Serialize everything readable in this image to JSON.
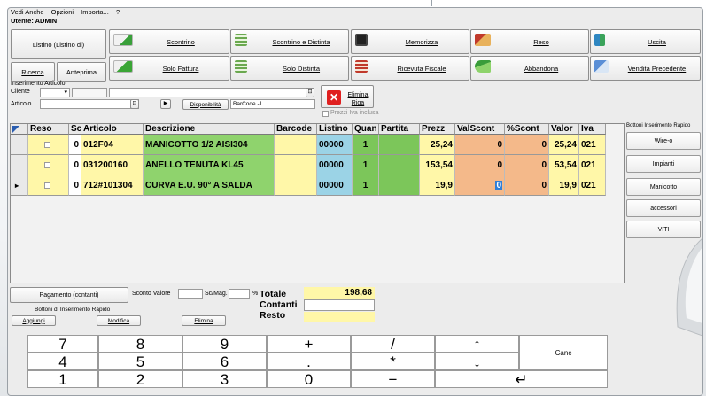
{
  "menu": [
    "Vedi Anche",
    "Opzioni",
    "Importa...",
    "?"
  ],
  "user_label": "Utente: ADMIN",
  "left_buttons": {
    "listino": "Listino (Listino di)",
    "ricerca": "Ricerca",
    "anteprima": "Anteprima"
  },
  "toolbar": {
    "scontrino": "Scontrino",
    "scontrino_distinta": "Scontrino e Distinta",
    "memorizza": "Memorizza",
    "reso": "Reso",
    "uscita": "Uscita",
    "solo_fattura": "Solo Fattura",
    "solo_distinta": "Solo Distinta",
    "ricevuta_fiscale": "Ricevuta Fiscale",
    "abbandona": "Abbandona",
    "vendita_precedente": "Vendita Precedente"
  },
  "insert": {
    "section_label": "Inserimento Articolo",
    "cliente_label": "Cliente",
    "articolo_label": "Articolo",
    "disponibilita": "Disponibilità",
    "barcode_value": "BarCode -1",
    "elimina_riga": "Elimina Riga",
    "prezzi_iva": "Prezzi Iva inclusa"
  },
  "grid": {
    "headers": [
      "Reso",
      "Sc",
      "Articolo",
      "Descrizione",
      "Barcode",
      "Listino",
      "Quan",
      "Partita",
      "Prezz",
      "ValScont",
      "%Scont",
      "Valor",
      "Iva"
    ],
    "rows": [
      {
        "sc": "0",
        "articolo": "012F04",
        "descrizione": "MANICOTTO 1/2 AISI304",
        "barcode": "",
        "listino": "00000",
        "quan": "1",
        "partita": "",
        "prezzo": "25,24",
        "valscont": "0",
        "pscont": "0",
        "valore": "25,24",
        "iva": "021"
      },
      {
        "sc": "0",
        "articolo": "031200160",
        "descrizione": "ANELLO TENUTA KL45",
        "barcode": "",
        "listino": "00000",
        "quan": "1",
        "partita": "",
        "prezzo": "153,54",
        "valscont": "0",
        "pscont": "0",
        "valore": "53,54",
        "iva": "021"
      },
      {
        "sc": "0",
        "articolo": "712#101304",
        "descrizione": "CURVA E.U. 90° A SALDA",
        "barcode": "",
        "listino": "00000",
        "quan": "1",
        "partita": "",
        "prezzo": "19,9",
        "valscont": "0",
        "pscont": "0",
        "valore": "19,9",
        "iva": "021"
      }
    ]
  },
  "quick": {
    "title": "Bottoni Inserimento Rapido",
    "buttons": [
      "Wire-o",
      "Impianti",
      "Manicotto",
      "accessori",
      "VITI"
    ]
  },
  "bottom": {
    "pagamento": "Pagamento (contanti)",
    "sconto_valore": "Sconto Valore",
    "sc_mag": "Sc/Mag.",
    "pct": "%",
    "totale_label": "Totale",
    "totale_value": "198,68",
    "contanti_label": "Contanti",
    "resto_label": "Resto",
    "bottoni_label": "Bottoni di Inserimento Rapido",
    "aggiungi": "Aggiungi",
    "modifica": "Modifica",
    "elimina": "Elimina"
  },
  "keypad": {
    "row1": [
      "7",
      "8",
      "9",
      "+",
      "/",
      "↑"
    ],
    "row2": [
      "4",
      "5",
      "6",
      ".",
      "*",
      "↓"
    ],
    "row3": [
      "1",
      "2",
      "3",
      "0",
      "−",
      "↵"
    ],
    "canc": "Canc"
  },
  "colors": {
    "yellow": "#fff7a8",
    "green": "#8fd36d",
    "cyan": "#9bd3e6",
    "peach": "#f4b98a",
    "partita_green": "#7cc65a"
  }
}
